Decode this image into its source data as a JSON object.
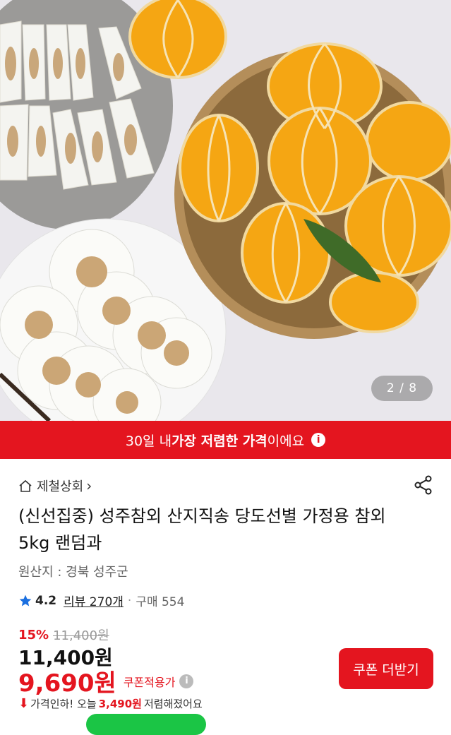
{
  "gallery": {
    "counter": "2 / 8"
  },
  "banner": {
    "prefix": "30일 내 ",
    "bold": "가장 저렴한 가격",
    "suffix": "이에요",
    "info_icon": "info-icon"
  },
  "store": {
    "name": "제철상회",
    "chevron": "›"
  },
  "product": {
    "title": "(신선집중) 성주참외 산지직송 당도선별 가정용 참외 5kg 랜덤과",
    "origin": "원산지 : 경북 성주군"
  },
  "rating": {
    "score": "4.2",
    "reviews": "리뷰 270개",
    "separator": "·",
    "sales": "구매 554"
  },
  "pricing": {
    "discount": "15%",
    "original": "11,400원",
    "price": "11,400원",
    "sale_price": "9,690원",
    "coupon_label": "쿠폰적용가",
    "drop_prefix": "가격인하! 오늘",
    "drop_amount": "3,490원",
    "drop_suffix": "저렴해졌어요"
  },
  "buttons": {
    "coupon": "쿠폰 더받기",
    "green": ""
  },
  "colors": {
    "accent": "#e4151f",
    "green": "#1bc545",
    "star": "#1a6fe0"
  }
}
